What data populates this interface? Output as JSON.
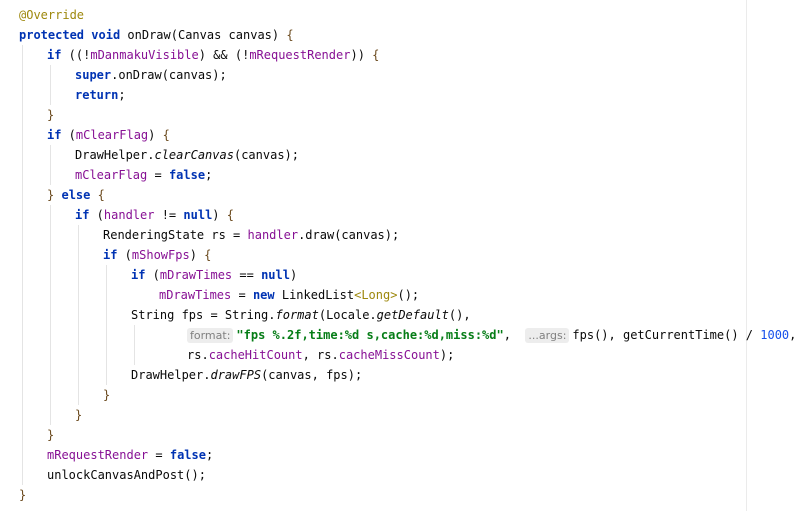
{
  "editor": {
    "language": "java",
    "colors": {
      "keyword": "#0033b3",
      "field": "#871094",
      "string": "#067d17",
      "number": "#1750eb",
      "annotation": "#9e880d"
    },
    "lines": [
      {
        "indent": 0,
        "tokens": [
          [
            "@Override",
            "ann"
          ]
        ]
      },
      {
        "indent": 0,
        "tokens": [
          [
            "protected",
            "kw"
          ],
          [
            " ",
            ""
          ],
          [
            "void",
            "kw"
          ],
          [
            " onDraw(Canvas canvas) ",
            ""
          ],
          [
            "{",
            "brace"
          ]
        ]
      },
      {
        "indent": 1,
        "tokens": [
          [
            "if",
            "kw"
          ],
          [
            " ((!",
            ""
          ],
          [
            "mDanmakuVisible",
            "fld"
          ],
          [
            ") && (!",
            ""
          ],
          [
            "mRequestRender",
            "fld"
          ],
          [
            ")) ",
            ""
          ],
          [
            "{",
            "brace"
          ]
        ]
      },
      {
        "indent": 2,
        "tokens": [
          [
            "super",
            "kw"
          ],
          [
            ".onDraw(canvas);",
            ""
          ]
        ]
      },
      {
        "indent": 2,
        "tokens": [
          [
            "return",
            "kw"
          ],
          [
            ";",
            ""
          ]
        ]
      },
      {
        "indent": 1,
        "tokens": [
          [
            "}",
            "brace"
          ]
        ]
      },
      {
        "indent": 1,
        "tokens": [
          [
            "if",
            "kw"
          ],
          [
            " (",
            ""
          ],
          [
            "mClearFlag",
            "fld"
          ],
          [
            ") ",
            ""
          ],
          [
            "{",
            "brace"
          ]
        ]
      },
      {
        "indent": 2,
        "tokens": [
          [
            "DrawHelper.",
            ""
          ],
          [
            "clearCanvas",
            "it"
          ],
          [
            "(canvas);",
            ""
          ]
        ]
      },
      {
        "indent": 2,
        "tokens": [
          [
            "mClearFlag",
            "fld"
          ],
          [
            " = ",
            ""
          ],
          [
            "false",
            "kw"
          ],
          [
            ";",
            ""
          ]
        ]
      },
      {
        "indent": 1,
        "tokens": [
          [
            "}",
            "brace"
          ],
          [
            " ",
            ""
          ],
          [
            "else",
            "kw"
          ],
          [
            " ",
            ""
          ],
          [
            "{",
            "brace"
          ]
        ]
      },
      {
        "indent": 2,
        "tokens": [
          [
            "if",
            "kw"
          ],
          [
            " (",
            ""
          ],
          [
            "handler",
            "fld"
          ],
          [
            " != ",
            ""
          ],
          [
            "null",
            "kw"
          ],
          [
            ") ",
            ""
          ],
          [
            "{",
            "brace"
          ]
        ]
      },
      {
        "indent": 3,
        "tokens": [
          [
            "RenderingState rs = ",
            ""
          ],
          [
            "handler",
            "fld"
          ],
          [
            ".draw(canvas);",
            ""
          ]
        ]
      },
      {
        "indent": 3,
        "tokens": [
          [
            "if",
            "kw"
          ],
          [
            " (",
            ""
          ],
          [
            "mShowFps",
            "fld"
          ],
          [
            ") ",
            ""
          ],
          [
            "{",
            "brace"
          ]
        ]
      },
      {
        "indent": 4,
        "tokens": [
          [
            "if",
            "kw"
          ],
          [
            " (",
            ""
          ],
          [
            "mDrawTimes",
            "fld"
          ],
          [
            " == ",
            ""
          ],
          [
            "null",
            "kw"
          ],
          [
            ")",
            ""
          ]
        ]
      },
      {
        "indent": 5,
        "tokens": [
          [
            "mDrawTimes",
            "fld"
          ],
          [
            " = ",
            ""
          ],
          [
            "new",
            "kw"
          ],
          [
            " LinkedList",
            ""
          ],
          [
            "<Long>",
            "gen"
          ],
          [
            "();",
            ""
          ]
        ]
      },
      {
        "indent": 4,
        "tokens": [
          [
            "String fps = String.",
            ""
          ],
          [
            "format",
            "it"
          ],
          [
            "(Locale.",
            ""
          ],
          [
            "getDefault",
            "it"
          ],
          [
            "(),",
            ""
          ]
        ]
      },
      {
        "indent": 6,
        "tokens": [
          [
            "format:",
            "hint"
          ],
          [
            "\"fps %.2f,time:%d s,cache:%d,miss:%d\"",
            "str"
          ],
          [
            ",  ",
            ""
          ],
          [
            "...args:",
            "hint"
          ],
          [
            "fps(), getCurrentTime() / ",
            ""
          ],
          [
            "1000",
            "num"
          ],
          [
            ",",
            ""
          ]
        ]
      },
      {
        "indent": 6,
        "tokens": [
          [
            "rs.",
            ""
          ],
          [
            "cacheHitCount",
            "fld"
          ],
          [
            ", rs.",
            ""
          ],
          [
            "cacheMissCount",
            "fld"
          ],
          [
            ");",
            ""
          ]
        ]
      },
      {
        "indent": 4,
        "tokens": [
          [
            "DrawHelper.",
            ""
          ],
          [
            "drawFPS",
            "it"
          ],
          [
            "(canvas, fps);",
            ""
          ]
        ]
      },
      {
        "indent": 3,
        "tokens": [
          [
            "}",
            "brace"
          ]
        ]
      },
      {
        "indent": 2,
        "tokens": [
          [
            "}",
            "brace"
          ]
        ]
      },
      {
        "indent": 1,
        "tokens": [
          [
            "}",
            "brace"
          ]
        ]
      },
      {
        "indent": 1,
        "tokens": [
          [
            "mRequestRender",
            "fld"
          ],
          [
            " = ",
            ""
          ],
          [
            "false",
            "kw"
          ],
          [
            ";",
            ""
          ]
        ]
      },
      {
        "indent": 1,
        "tokens": [
          [
            "unlockCanvasAndPost();",
            ""
          ]
        ]
      },
      {
        "indent": 0,
        "tokens": [
          [
            "}",
            "brace"
          ]
        ]
      }
    ]
  }
}
